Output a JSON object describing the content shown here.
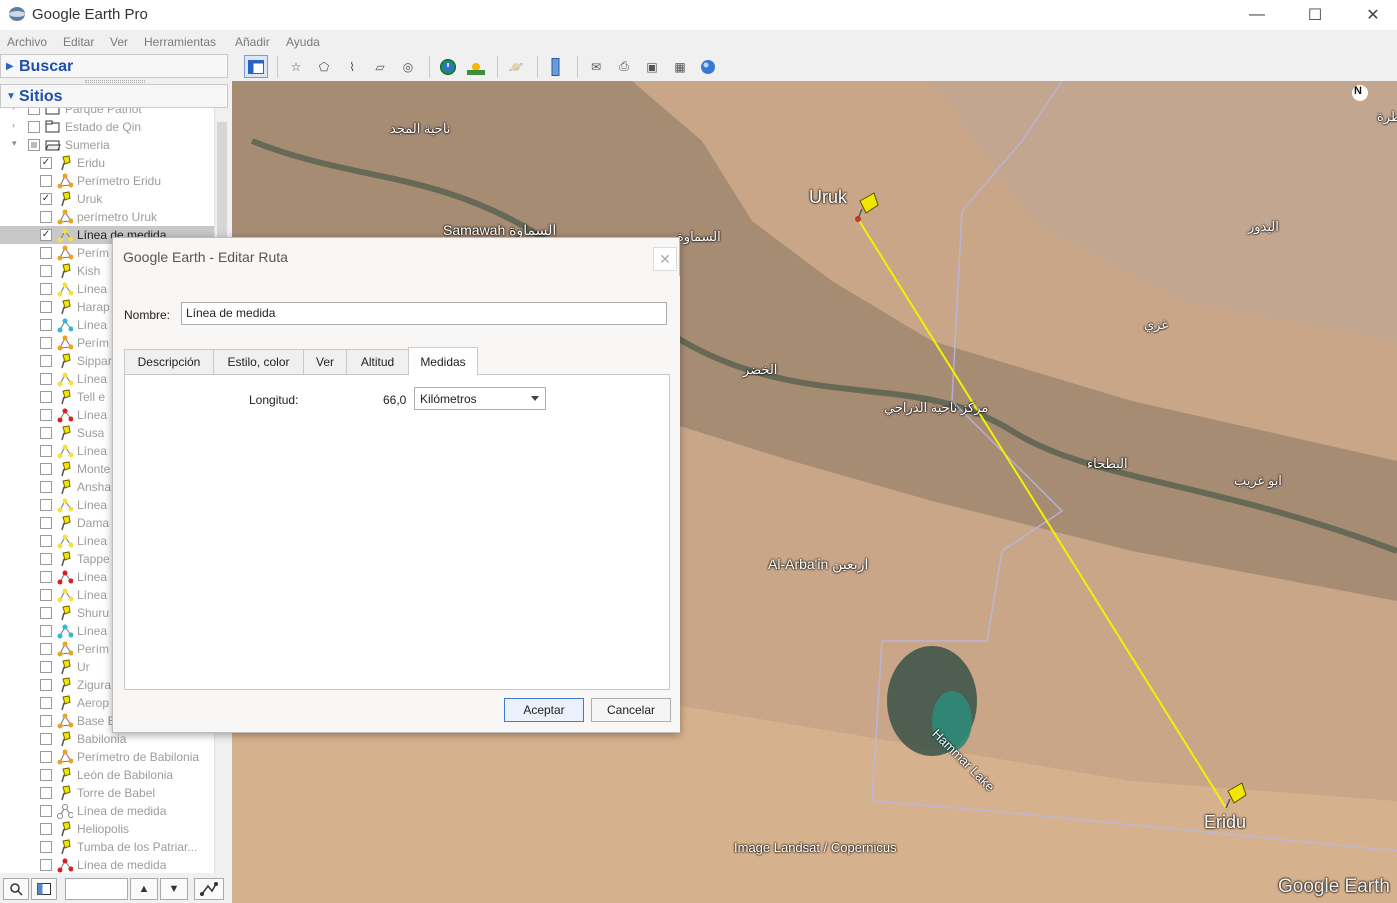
{
  "window": {
    "title": "Google Earth Pro",
    "controls": [
      "—",
      "☐",
      "✕"
    ]
  },
  "menu": [
    "Archivo",
    "Editar",
    "Ver",
    "Herramientas",
    "Añadir",
    "Ayuda"
  ],
  "search_panel": {
    "label": "Buscar"
  },
  "places_panel": {
    "label": "Sitios"
  },
  "tree_items": [
    {
      "label": "Parque Patriot",
      "icon": "folder",
      "checked": false,
      "indent": 1
    },
    {
      "label": "Estado de Qin",
      "icon": "folder",
      "checked": false,
      "indent": 1
    },
    {
      "label": "Sumeria",
      "icon": "folder-open",
      "checked": "partial",
      "indent": 1
    },
    {
      "label": "Eridu",
      "icon": "pin",
      "checked": true,
      "indent": 2
    },
    {
      "label": "Perímetro Eridu",
      "icon": "polygon-orange",
      "checked": false,
      "indent": 2
    },
    {
      "label": "Uruk",
      "icon": "pin",
      "checked": true,
      "indent": 2
    },
    {
      "label": "perímetro Uruk",
      "icon": "polygon-orange",
      "checked": false,
      "indent": 2
    },
    {
      "label": "Línea de medida",
      "icon": "path-yellow",
      "checked": true,
      "indent": 2,
      "selected": true
    },
    {
      "label": "Perím",
      "icon": "polygon-orange",
      "checked": false,
      "indent": 2
    },
    {
      "label": "Kish",
      "icon": "pin",
      "checked": false,
      "indent": 2
    },
    {
      "label": "Línea",
      "icon": "path-yellow",
      "checked": false,
      "indent": 2
    },
    {
      "label": "Harap",
      "icon": "pin",
      "checked": false,
      "indent": 2
    },
    {
      "label": "Línea",
      "icon": "path-cyan",
      "checked": false,
      "indent": 2
    },
    {
      "label": "Perím",
      "icon": "polygon-orange",
      "checked": false,
      "indent": 2
    },
    {
      "label": "Sippar",
      "icon": "pin",
      "checked": false,
      "indent": 2
    },
    {
      "label": "Línea",
      "icon": "path-yellow",
      "checked": false,
      "indent": 2
    },
    {
      "label": "Tell e",
      "icon": "pin",
      "checked": false,
      "indent": 2
    },
    {
      "label": "Línea",
      "icon": "path-red",
      "checked": false,
      "indent": 2
    },
    {
      "label": "Susa",
      "icon": "pin",
      "checked": false,
      "indent": 2
    },
    {
      "label": "Línea",
      "icon": "path-yellow",
      "checked": false,
      "indent": 2
    },
    {
      "label": "Monte",
      "icon": "pin",
      "checked": false,
      "indent": 2
    },
    {
      "label": "Ansha",
      "icon": "pin",
      "checked": false,
      "indent": 2
    },
    {
      "label": "Línea",
      "icon": "path-yellow",
      "checked": false,
      "indent": 2
    },
    {
      "label": "Dama",
      "icon": "pin",
      "checked": false,
      "indent": 2
    },
    {
      "label": "Línea",
      "icon": "path-yellow",
      "checked": false,
      "indent": 2
    },
    {
      "label": "Tappe",
      "icon": "pin",
      "checked": false,
      "indent": 2
    },
    {
      "label": "Línea",
      "icon": "path-red",
      "checked": false,
      "indent": 2
    },
    {
      "label": "Línea",
      "icon": "path-yellow",
      "checked": false,
      "indent": 2
    },
    {
      "label": "Shuru",
      "icon": "pin",
      "checked": false,
      "indent": 2
    },
    {
      "label": "Línea",
      "icon": "path-cyan",
      "checked": false,
      "indent": 2
    },
    {
      "label": "Perím",
      "icon": "polygon-orange",
      "checked": false,
      "indent": 2
    },
    {
      "label": "Ur",
      "icon": "pin",
      "checked": false,
      "indent": 2
    },
    {
      "label": "Zigura",
      "icon": "pin",
      "checked": false,
      "indent": 2
    },
    {
      "label": "Aerop",
      "icon": "pin",
      "checked": false,
      "indent": 2
    },
    {
      "label": "Base B",
      "icon": "polygon-orange",
      "checked": false,
      "indent": 2
    },
    {
      "label": "Babilonia",
      "icon": "pin",
      "checked": false,
      "indent": 2
    },
    {
      "label": "Perímetro de Babilonia",
      "icon": "polygon-orange",
      "checked": false,
      "indent": 2
    },
    {
      "label": "León de Babilonia",
      "icon": "pin",
      "checked": false,
      "indent": 2
    },
    {
      "label": "Torre de Babel",
      "icon": "pin",
      "checked": false,
      "indent": 2
    },
    {
      "label": "Línea de medida",
      "icon": "path-white",
      "checked": false,
      "indent": 2
    },
    {
      "label": "Heliopolis",
      "icon": "pin",
      "checked": false,
      "indent": 2
    },
    {
      "label": "Tumba de los Patriar...",
      "icon": "pin",
      "checked": false,
      "indent": 2
    },
    {
      "label": "Línea de medida",
      "icon": "path-red",
      "checked": false,
      "indent": 2
    }
  ],
  "map": {
    "labels": [
      {
        "text": "ناحية المجد"
      },
      {
        "text": "Uruk"
      },
      {
        "text": "Samawah السماوة"
      },
      {
        "text": "السماوة"
      },
      {
        "text": "البدور"
      },
      {
        "text": "غزي"
      },
      {
        "text": "الخضر"
      },
      {
        "text": "مركز ناحية الدراجي"
      },
      {
        "text": "البطحاء"
      },
      {
        "text": "ابو غريب"
      },
      {
        "text": "Al-Arba'in اربعين"
      },
      {
        "text": "Hammar Lake"
      },
      {
        "text": "Eridu"
      },
      {
        "text": "Image Landsat / Copernicus"
      },
      {
        "text": "Google Earth"
      },
      {
        "text": "طرة"
      }
    ],
    "compass": "N",
    "path_color": "#f2f200"
  },
  "dialog": {
    "title": "Google Earth - Editar Ruta",
    "name_label": "Nombre:",
    "name_value": "Línea de medida",
    "tabs": [
      "Descripción",
      "Estilo, color",
      "Ver",
      "Altitud",
      "Medidas"
    ],
    "active_tab": "Medidas",
    "length_label": "Longitud:",
    "length_value": "66,0",
    "unit": "Kilómetros",
    "ok_label": "Aceptar",
    "cancel_label": "Cancelar"
  }
}
